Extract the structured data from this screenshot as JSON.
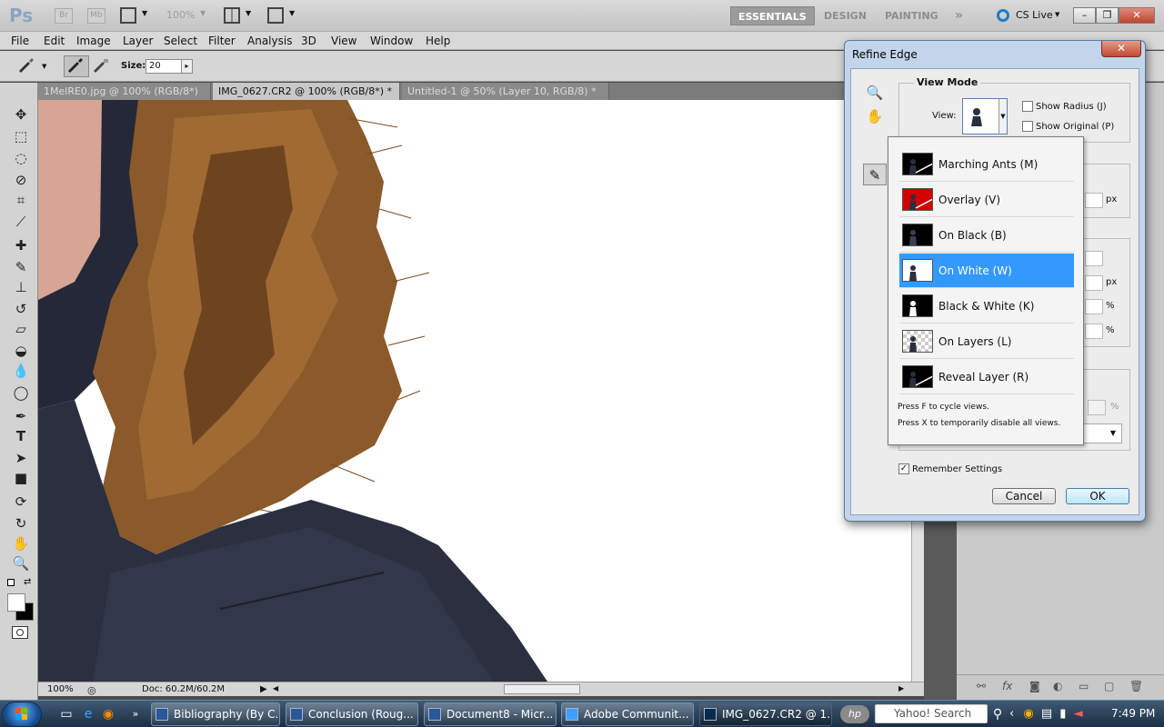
{
  "app": {
    "logo": "Ps",
    "bridge_btn": "Br",
    "minibridge_btn": "Mb",
    "zoom_level": "100%",
    "workspaces": [
      "ESSENTIALS",
      "DESIGN",
      "PAINTING"
    ],
    "more_workspaces": "»",
    "cs_live": "CS Live"
  },
  "menu": [
    "File",
    "Edit",
    "Image",
    "Layer",
    "Select",
    "Filter",
    "Analysis",
    "3D",
    "View",
    "Window",
    "Help"
  ],
  "options": {
    "size_label": "Size:",
    "size_value": "20"
  },
  "tabs": [
    {
      "label": "1MelRE0.jpg @ 100% (RGB/8*)"
    },
    {
      "label": "IMG_0627.CR2 @ 100% (RGB/8*) *"
    },
    {
      "label": "Untitled-1 @ 50% (Layer 10, RGB/8) *"
    }
  ],
  "status": {
    "zoom": "100%",
    "doc": "Doc: 60.2M/60.2M"
  },
  "dialog": {
    "title": "Refine Edge",
    "close": "✕",
    "view_mode_title": "View Mode",
    "view_label": "View:",
    "show_radius": "Show Radius (J)",
    "show_original": "Show Original (P)",
    "unit_px_1": "px",
    "unit_px_2": "px",
    "unit_pct_1": "%",
    "unit_pct_2": "%",
    "unit_pct_3": "%",
    "remember": "Remember Settings",
    "remember_checked": true,
    "cancel": "Cancel",
    "ok": "OK"
  },
  "view_modes": [
    {
      "label": "Marching Ants (M)",
      "bg": "#000000",
      "selected": false
    },
    {
      "label": "Overlay (V)",
      "bg": "#d40000",
      "selected": false
    },
    {
      "label": "On Black (B)",
      "bg": "#000000",
      "selected": false
    },
    {
      "label": "On White (W)",
      "bg": "#ffffff",
      "selected": true
    },
    {
      "label": "Black & White (K)",
      "bg": "#000000",
      "selected": false
    },
    {
      "label": "On Layers (L)",
      "bg": "checker",
      "selected": false
    },
    {
      "label": "Reveal Layer (R)",
      "bg": "#000000",
      "selected": false
    }
  ],
  "view_hints": [
    "Press F to cycle views.",
    "Press X to temporarily disable all views."
  ],
  "taskbar": {
    "tasks": [
      "Bibliography (By C...",
      "Conclusion (Roug...",
      "Document8 - Micr...",
      "Adobe Communit...",
      "IMG_0627.CR2 @ 1..."
    ],
    "search": "Yahoo! Search",
    "clock": "7:49 PM"
  },
  "colors": {
    "accent_selected": "#3399ff",
    "hair": "#8a5a2b",
    "jacket": "#2b2f3f"
  }
}
